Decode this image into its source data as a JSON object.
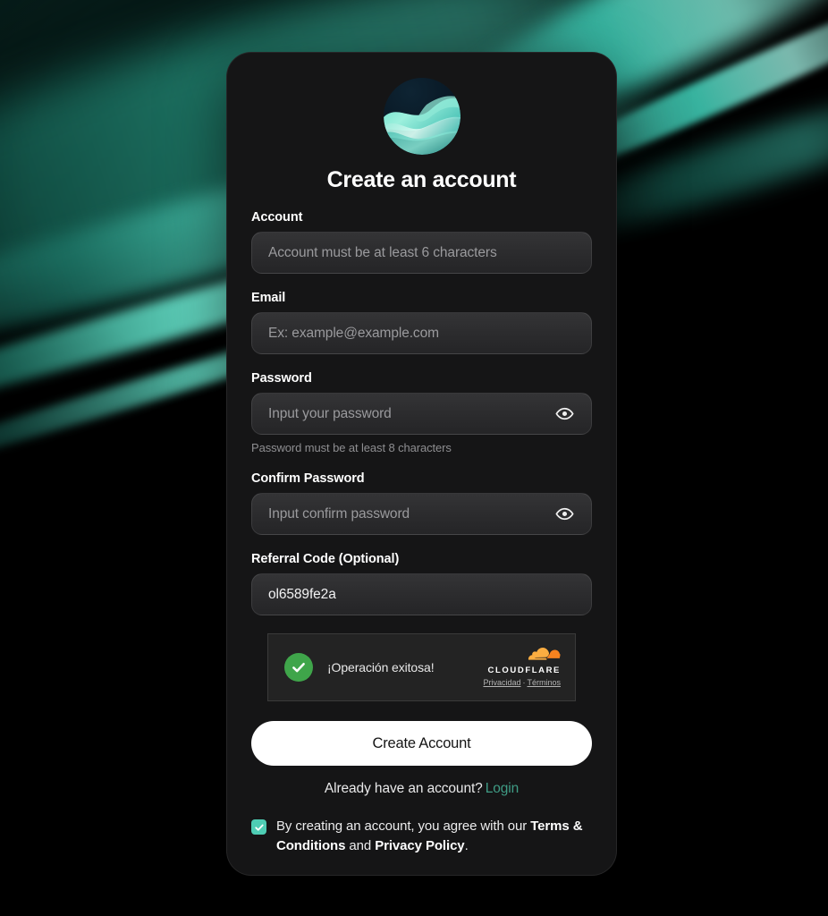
{
  "card": {
    "logo_icon": "wave-orb-logo",
    "title": "Create an account"
  },
  "fields": {
    "account": {
      "label": "Account",
      "placeholder": "Account must be at least 6 characters",
      "value": ""
    },
    "email": {
      "label": "Email",
      "placeholder": "Ex: example@example.com",
      "value": ""
    },
    "password": {
      "label": "Password",
      "placeholder": "Input your password",
      "value": "",
      "helper": "Password must be at least 8 characters",
      "toggle_icon": "eye-icon"
    },
    "confirm_password": {
      "label": "Confirm Password",
      "placeholder": "Input confirm password",
      "value": "",
      "toggle_icon": "eye-icon"
    },
    "referral": {
      "label": "Referral Code (Optional)",
      "placeholder": "",
      "value": "ol6589fe2a"
    }
  },
  "turnstile": {
    "status_text": "¡Operación exitosa!",
    "status_icon": "green-check-circle-icon",
    "brand_icon": "cloudflare-cloud-icon",
    "brand_name": "CLOUDFLARE",
    "privacy_link": "Privacidad",
    "separator": "·",
    "terms_link": "Términos"
  },
  "actions": {
    "submit_label": "Create Account",
    "login_prompt": "Already have an account?",
    "login_label": "Login"
  },
  "terms": {
    "checked": true,
    "line1_prefix": "By creating an account, you agree with our",
    "terms_label": "Terms & Conditions",
    "conjunction": "and",
    "privacy_label": "Privacy Policy",
    "period": "."
  },
  "colors": {
    "page_background": "#000000",
    "card_background": "#151516",
    "accent_teal": "#4ecdb4",
    "link_teal": "#3f9c85",
    "submit_background": "#ffffff",
    "success_green": "#3fa54a",
    "cloudflare_orange": "#f48120"
  }
}
